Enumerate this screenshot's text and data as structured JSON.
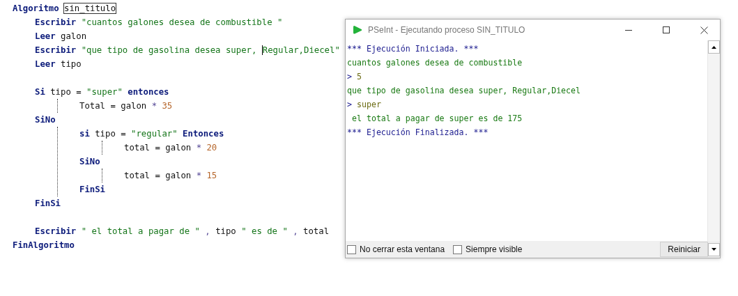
{
  "editor": {
    "lines": [
      {
        "kind": "code",
        "tokens": [
          {
            "kind": "keyword",
            "text": "Algoritmo "
          },
          {
            "kind": "ident",
            "text": "sin_titulo",
            "highlight": true
          }
        ],
        "children": [
          {
            "kind": "code",
            "tokens": [
              {
                "kind": "keyword",
                "text": "Escribir"
              },
              {
                "kind": "string",
                "text": " \"cuantos galones desea de combustible \""
              }
            ]
          },
          {
            "kind": "code",
            "tokens": [
              {
                "kind": "keyword",
                "text": "Leer"
              },
              {
                "kind": "ident",
                "text": " galon"
              }
            ]
          },
          {
            "kind": "code",
            "tokens": [
              {
                "kind": "keyword",
                "text": "Escribir"
              },
              {
                "kind": "string",
                "text": " \"que tipo de gasolina desea super, "
              },
              {
                "kind": "string",
                "text": "Regular,Diecel\"",
                "caret": true
              }
            ]
          },
          {
            "kind": "code",
            "tokens": [
              {
                "kind": "keyword",
                "text": "Leer"
              },
              {
                "kind": "ident",
                "text": " tipo"
              }
            ]
          },
          {
            "kind": "blank"
          },
          {
            "kind": "code",
            "tokens": [
              {
                "kind": "keyword",
                "text": "Si"
              },
              {
                "kind": "ident",
                "text": " tipo = "
              },
              {
                "kind": "string",
                "text": "\"super\""
              },
              {
                "kind": "keyword",
                "text": " entonces"
              }
            ],
            "children": [
              {
                "kind": "code",
                "tokens": [
                  {
                    "kind": "ident",
                    "text": "Total = galon "
                  },
                  {
                    "kind": "op",
                    "text": "*"
                  },
                  {
                    "kind": "number",
                    "text": " 35"
                  }
                ]
              }
            ]
          },
          {
            "kind": "code",
            "tokens": [
              {
                "kind": "keyword",
                "text": "SiNo"
              }
            ],
            "children": [
              {
                "kind": "code",
                "tokens": [
                  {
                    "kind": "keyword",
                    "text": "si"
                  },
                  {
                    "kind": "ident",
                    "text": " tipo = "
                  },
                  {
                    "kind": "string",
                    "text": "\"regular\""
                  },
                  {
                    "kind": "keyword",
                    "text": " Entonces"
                  }
                ],
                "children": [
                  {
                    "kind": "code",
                    "tokens": [
                      {
                        "kind": "ident",
                        "text": "total = galon "
                      },
                      {
                        "kind": "op",
                        "text": "*"
                      },
                      {
                        "kind": "number",
                        "text": " 20"
                      }
                    ]
                  }
                ]
              },
              {
                "kind": "code",
                "tokens": [
                  {
                    "kind": "keyword",
                    "text": "SiNo"
                  }
                ],
                "children": [
                  {
                    "kind": "code",
                    "tokens": [
                      {
                        "kind": "ident",
                        "text": "total = galon "
                      },
                      {
                        "kind": "op",
                        "text": "*"
                      },
                      {
                        "kind": "number",
                        "text": " 15"
                      }
                    ]
                  }
                ]
              },
              {
                "kind": "code",
                "tokens": [
                  {
                    "kind": "keyword",
                    "text": "FinSi"
                  }
                ]
              }
            ]
          },
          {
            "kind": "code",
            "tokens": [
              {
                "kind": "keyword",
                "text": "FinSi"
              }
            ]
          },
          {
            "kind": "blank"
          },
          {
            "kind": "code",
            "tokens": [
              {
                "kind": "keyword",
                "text": "Escribir"
              },
              {
                "kind": "string",
                "text": " \" el total a pagar de \""
              },
              {
                "kind": "op",
                "text": " , "
              },
              {
                "kind": "ident",
                "text": "tipo "
              },
              {
                "kind": "string",
                "text": "\" es de \""
              },
              {
                "kind": "op",
                "text": " , "
              },
              {
                "kind": "ident",
                "text": "total"
              }
            ]
          }
        ]
      },
      {
        "kind": "code",
        "tokens": [
          {
            "kind": "keyword",
            "text": "FinAlgoritmo"
          }
        ]
      }
    ]
  },
  "console_window": {
    "title": "PSeInt - Ejecutando proceso SIN_TITULO",
    "lines": [
      {
        "kind": "system",
        "text": "*** Ejecución Iniciada. ***"
      },
      {
        "kind": "output",
        "text": "cuantos galones desea de combustible"
      },
      {
        "kind": "input",
        "prompt": ">",
        "value": "5"
      },
      {
        "kind": "output",
        "text": "que tipo de gasolina desea super, Regular,Diecel"
      },
      {
        "kind": "input",
        "prompt": ">",
        "value": "super"
      },
      {
        "kind": "output",
        "text": " el total a pagar de super es de 175"
      },
      {
        "kind": "system",
        "text": "*** Ejecución Finalizada. ***"
      }
    ],
    "options": [
      {
        "label": "No cerrar esta ventana",
        "checked": false
      },
      {
        "label": "Siempre visible",
        "checked": false
      }
    ],
    "button": "Reiniciar"
  }
}
